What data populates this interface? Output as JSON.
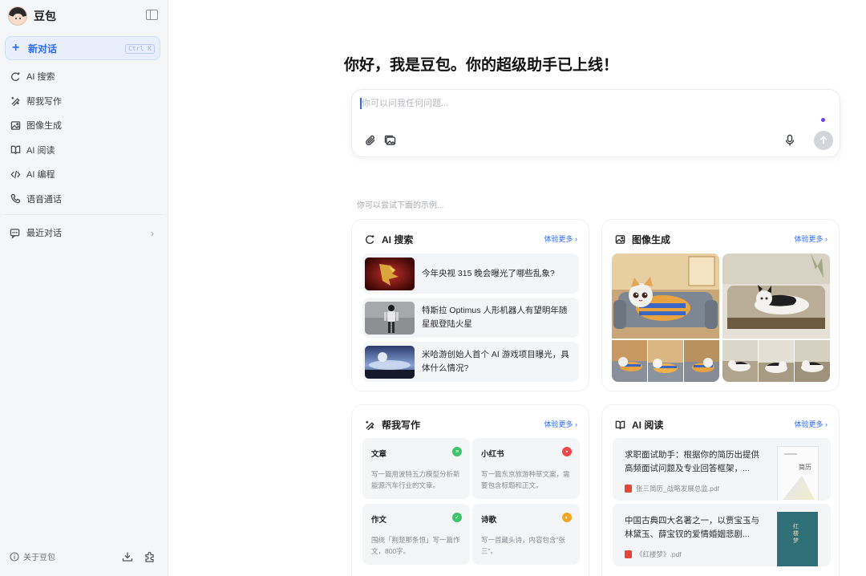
{
  "brand": {
    "name": "豆包"
  },
  "sidebar": {
    "new_chat": {
      "label": "新对话",
      "shortcut": "Ctrl K"
    },
    "items": [
      {
        "label": "AI 搜索",
        "icon": "search-spark-icon"
      },
      {
        "label": "帮我写作",
        "icon": "pen-icon"
      },
      {
        "label": "图像生成",
        "icon": "image-icon"
      },
      {
        "label": "AI 阅读",
        "icon": "book-icon"
      },
      {
        "label": "AI 编程",
        "icon": "code-icon"
      },
      {
        "label": "语音通话",
        "icon": "phone-icon"
      }
    ],
    "recent": "最近对话",
    "about": "关于豆包"
  },
  "main": {
    "greeting": "你好，我是豆包。你的超级助手已上线！",
    "composer": {
      "placeholder": "你可以问我任何问题..."
    },
    "try_hint": "你可以尝试下面的示例..."
  },
  "cards": {
    "search": {
      "title": "AI 搜索",
      "more": "体验更多 ›",
      "items": [
        "今年央视 315 晚会曝光了哪些乱象?",
        "特斯拉 Optimus 人形机器人有望明年随星舰登陆火星",
        "米哈游创始人首个 AI 游戏项目曝光，具体什么情况?"
      ]
    },
    "image": {
      "title": "图像生成",
      "more": "体验更多 ›"
    },
    "write": {
      "title": "帮我写作",
      "more": "体验更多 ›",
      "tiles": [
        {
          "title": "文章",
          "body": "写一篇用波特五力模型分析新能源汽车行业的文章。",
          "badge_color": "#3fc46b"
        },
        {
          "title": "小红书",
          "body": "写一篇东京旅游种草文案，需要包含标题和正文。",
          "badge_color": "#f04848"
        },
        {
          "title": "作文",
          "body": "围绕「荆楚那条恒」写一篇作文，800字。",
          "badge_color": "#3fc46b"
        },
        {
          "title": "诗歌",
          "body": "写一首藏头诗，内容包含\"张三\"。",
          "badge_color": "#f5a623"
        }
      ]
    },
    "read": {
      "title": "AI 阅读",
      "more": "体验更多 ›",
      "items": [
        {
          "desc": "求职面试助手：根据你的简历出提供高频面试问题及专业回答框架，...",
          "file": "张三简历_战略发展总监.pdf",
          "thumb_text": "简历"
        },
        {
          "desc": "中国古典四大名著之一，以贾宝玉与林黛玉、薛宝钗的爱情婚姻悲剧...",
          "file": "《红楼梦》.pdf",
          "thumb_text": "红楼梦"
        }
      ]
    }
  },
  "colors": {
    "accent": "#2f6df2",
    "sidebar_bg": "#f5f6f8",
    "voice_dot": "#6a3de8"
  }
}
